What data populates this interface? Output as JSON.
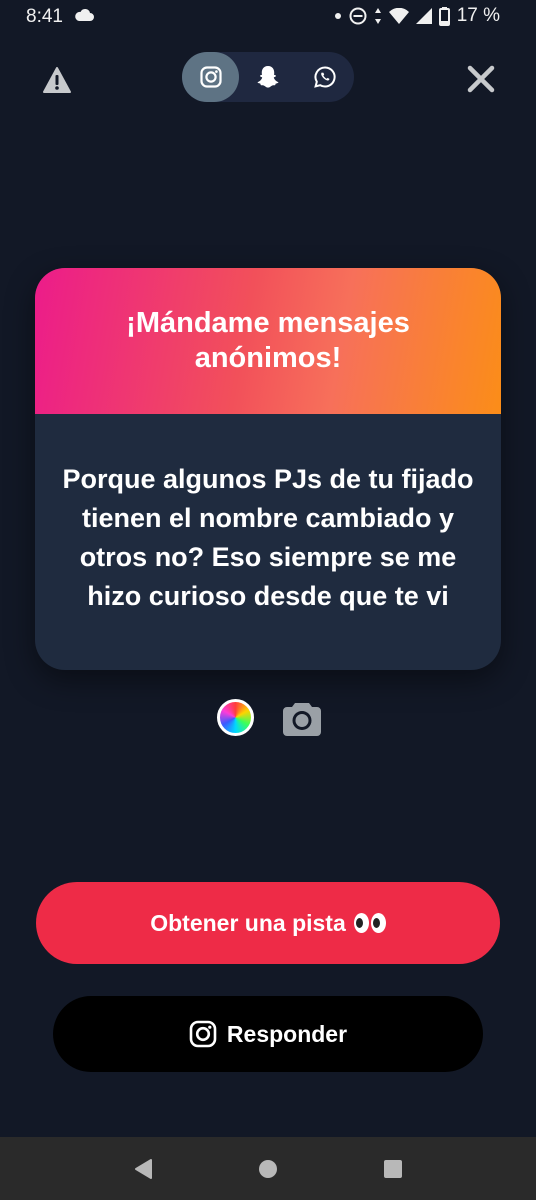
{
  "status_bar": {
    "time": "8:41",
    "battery": "17 %"
  },
  "top_bar": {
    "tabs": [
      {
        "id": "instagram",
        "icon": "instagram-icon",
        "active": true
      },
      {
        "id": "snapchat",
        "icon": "snapchat-icon",
        "active": false
      },
      {
        "id": "whatsapp",
        "icon": "whatsapp-icon",
        "active": false
      }
    ]
  },
  "card": {
    "title": "¡Mándame mensajes anónimos!",
    "message": "Porque algunos PJs de tu fijado tienen el nombre cambiado y otros no? Eso siempre se me hizo curioso desde que te vi"
  },
  "buttons": {
    "hint_label": "Obtener una pista",
    "reply_label": "Responder"
  },
  "colors": {
    "background": "#121826",
    "card_body": "#1f2b3f",
    "hint_button": "#ee2b47",
    "reply_button": "#000000",
    "gradient_start": "#ec1c8a",
    "gradient_end": "#fb8d18"
  }
}
